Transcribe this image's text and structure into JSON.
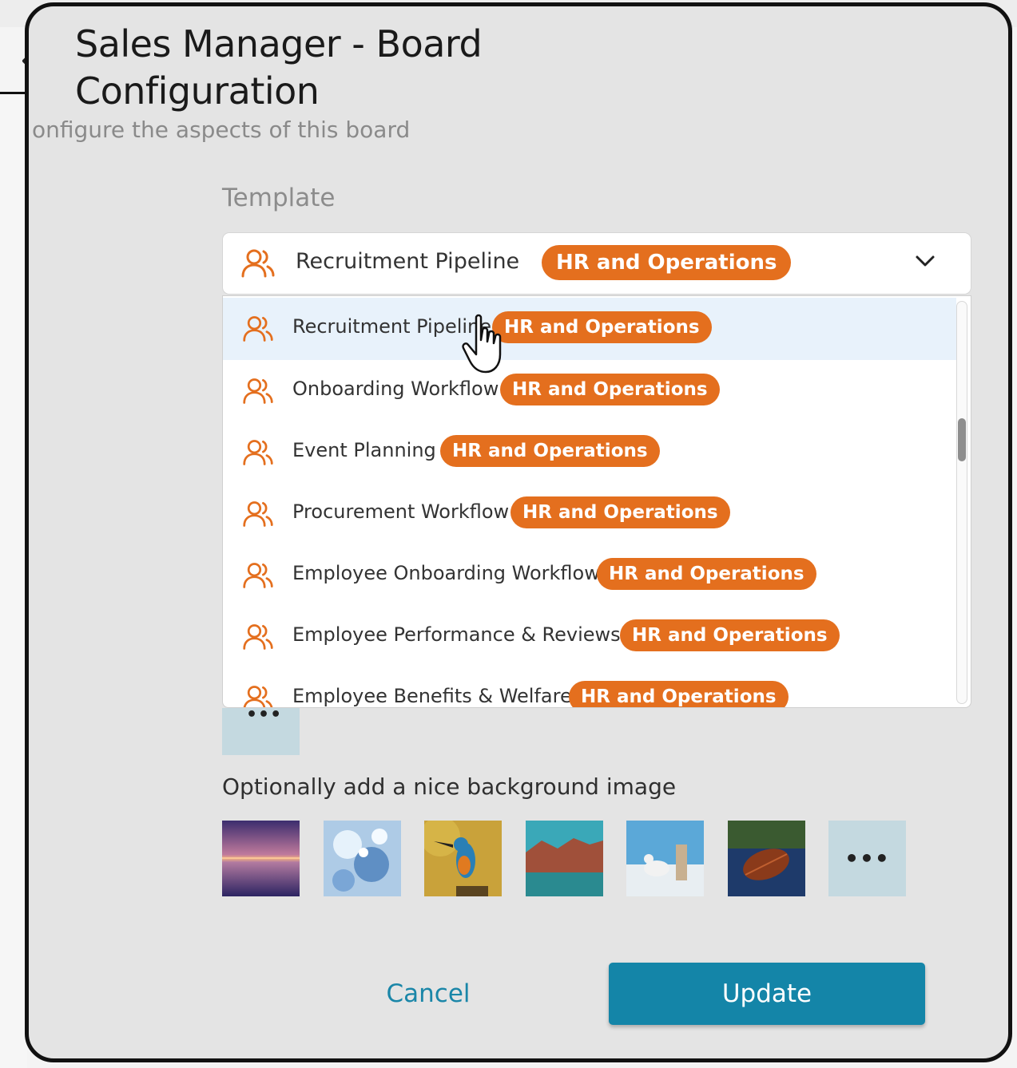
{
  "modal": {
    "title": "Sales Manager - Board Configuration",
    "subtitle": "onfigure the aspects of this board"
  },
  "template": {
    "label": "Template",
    "selected": {
      "name": "Recruitment Pipeline",
      "category": "HR and Operations",
      "icon": "users-icon"
    },
    "options": [
      {
        "name": "Recruitment Pipeline",
        "category": "HR and Operations",
        "icon": "users-icon",
        "hovered": true
      },
      {
        "name": "Onboarding Workflow",
        "category": "HR and Operations",
        "icon": "users-icon"
      },
      {
        "name": "Event Planning",
        "category": "HR and Operations",
        "icon": "users-icon"
      },
      {
        "name": "Procurement Workflow",
        "category": "HR and Operations",
        "icon": "users-icon"
      },
      {
        "name": "Employee Onboarding Workflow",
        "category": "HR and Operations",
        "icon": "users-icon"
      },
      {
        "name": "Employee Performance & Reviews",
        "category": "HR and Operations",
        "icon": "users-icon"
      },
      {
        "name": "Employee Benefits & Welfare",
        "category": "HR and Operations",
        "icon": "users-icon"
      }
    ]
  },
  "background": {
    "label": "Optionally add a nice background image",
    "images": [
      "sunset-lake",
      "water-splash",
      "kingfisher-bird",
      "rocky-coast",
      "seagull-lighthouse",
      "autumn-leaf"
    ],
    "more_label": "•••"
  },
  "actions": {
    "cancel_label": "Cancel",
    "update_label": "Update"
  },
  "colors": {
    "badge": "#e46f1e",
    "primary": "#1485a8",
    "hover_row": "#e8f2fb",
    "icon": "#e46f1e"
  }
}
